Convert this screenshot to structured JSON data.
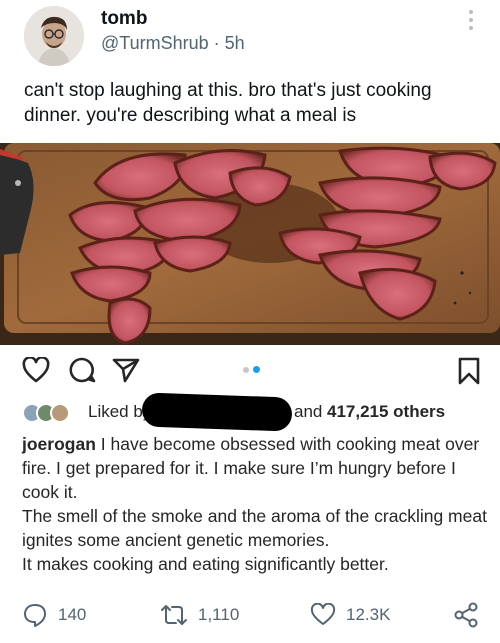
{
  "tweet": {
    "display_name": "tomb",
    "handle": "@TurmShrub",
    "separator": "·",
    "time": "5h",
    "text": "can't stop laughing at this. bro that's just cooking dinner. you're describing what a meal is",
    "icons": [
      "more-vertical-icon",
      "reply-icon",
      "retweet-icon",
      "like-icon",
      "share-icon"
    ]
  },
  "instagram_post": {
    "icons": [
      "heart-icon",
      "comment-icon",
      "send-icon",
      "bookmark-icon"
    ],
    "liked_by_prefix": "Liked by",
    "liked_by_suffix": "and",
    "liked_by_count": "417,215 others",
    "caption_user": "joerogan",
    "caption_lines": [
      "I have become obsessed with cooking meat over fire.  I get prepared for it.  I make sure I’m hungry before I cook it.",
      "The smell of the smoke and the aroma of the crackling meat ignites some ancient genetic memories.",
      "It makes cooking and eating significantly better."
    ]
  },
  "metrics": {
    "replies": "140",
    "retweets": "1,110",
    "likes": "12.3K"
  }
}
